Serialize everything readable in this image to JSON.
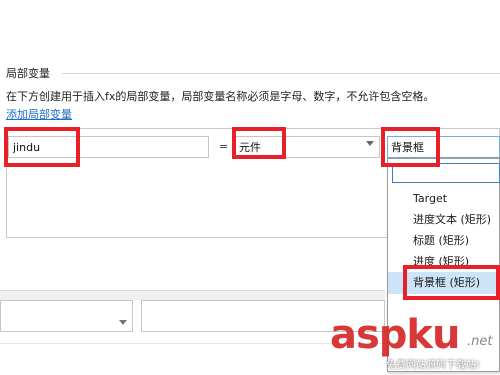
{
  "section": {
    "title": "局部变量",
    "description": "在下方创建用于插入fx的局部变量，局部变量名称必须是字母、数字，不允许包含空格。",
    "add_link": "添加局部变量"
  },
  "variable_row": {
    "name_value": "jindu",
    "equals": "=",
    "type_value": "元件",
    "target_value": "背景框"
  },
  "target_dropdown": {
    "search_value": "",
    "items": [
      {
        "label": "Target",
        "selected": false
      },
      {
        "label": "进度文本 (矩形)",
        "selected": false
      },
      {
        "label": "标题 (矩形)",
        "selected": false
      },
      {
        "label": "进度 (矩形)",
        "selected": false
      },
      {
        "label": "背景框 (矩形)",
        "selected": true
      }
    ]
  },
  "watermark": {
    "main": "aspku",
    "suffix": ".net",
    "sub": "免费网站源码下载站!"
  },
  "colors": {
    "highlight": "#e8202a",
    "link": "#1a6fc9",
    "selected_item": "#cde3f7"
  }
}
